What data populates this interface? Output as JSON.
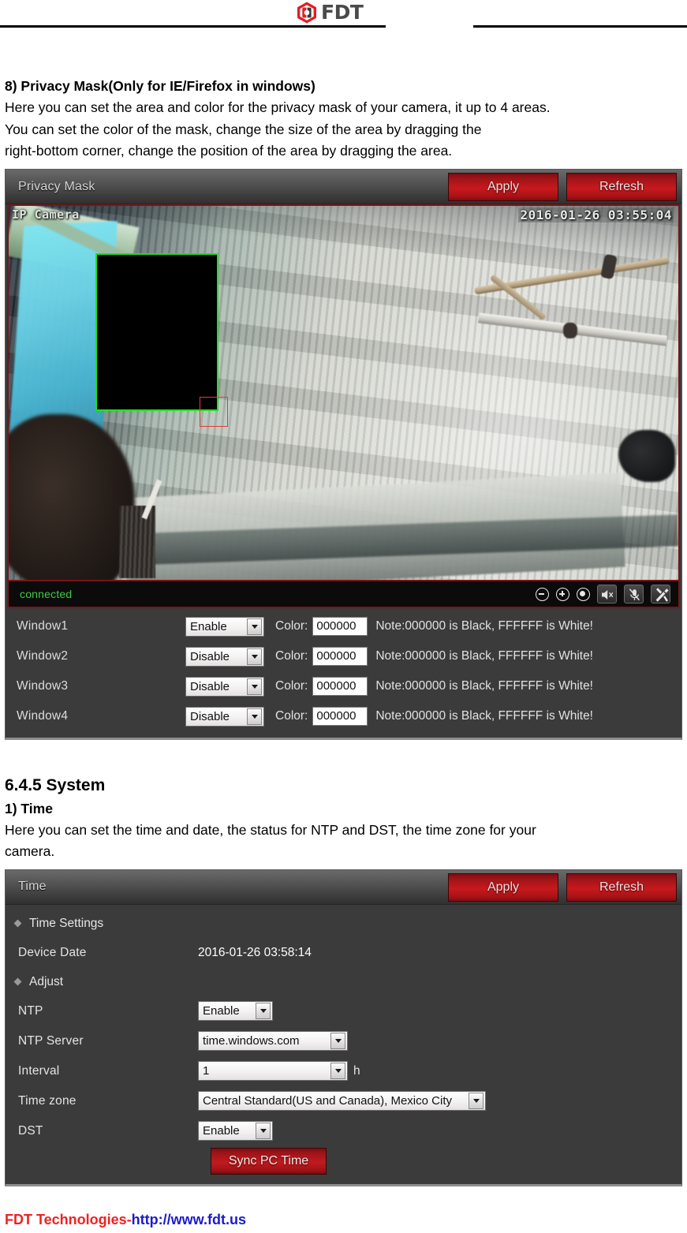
{
  "header": {
    "logo_text": "FDT",
    "logo_icon": "fdt-hexagon-logo"
  },
  "doc": {
    "section8_heading": "8) Privacy Mask(Only for IE/Firefox in windows)",
    "section8_para_line1": "Here you can set the area and color for the privacy mask of your camera, it up to 4 areas.",
    "section8_para_line2": "You can set the color of the mask, change the size of the area by dragging the",
    "section8_para_line3": "right-bottom corner, change the position of the area by dragging the area.",
    "section645_heading": "6.4.5 System",
    "subsection1_heading": "1) Time",
    "subsection1_para_line1": "Here you can set the time and date, the status for NTP and DST, the time zone for your",
    "subsection1_para_line2": "camera."
  },
  "privacy_panel": {
    "title": "Privacy Mask",
    "apply_label": "Apply",
    "refresh_label": "Refresh",
    "video": {
      "overlay_label": "IP Camera",
      "overlay_timestamp": "2016-01-26  03:55:04",
      "status_text": "connected",
      "icons": [
        "zoom-out-icon",
        "zoom-in-icon",
        "record-dot-icon",
        "speaker-mute-icon",
        "mic-mute-icon",
        "tools-icon"
      ]
    },
    "color_label": "Color:",
    "note_text": "Note:000000 is Black, FFFFFF is White!",
    "rows": [
      {
        "label": "Window1",
        "state": "Enable",
        "color": "000000"
      },
      {
        "label": "Window2",
        "state": "Disable",
        "color": "000000"
      },
      {
        "label": "Window3",
        "state": "Disable",
        "color": "000000"
      },
      {
        "label": "Window4",
        "state": "Disable",
        "color": "000000"
      }
    ],
    "state_options": [
      "Enable",
      "Disable"
    ]
  },
  "time_panel": {
    "title": "Time",
    "apply_label": "Apply",
    "refresh_label": "Refresh",
    "group_time_settings": "Time Settings",
    "group_adjust": "Adjust",
    "device_date_label": "Device Date",
    "device_date_value": "2016-01-26 03:58:14",
    "ntp_label": "NTP",
    "ntp_value": "Enable",
    "ntp_options": [
      "Enable",
      "Disable"
    ],
    "ntp_server_label": "NTP Server",
    "ntp_server_value": "time.windows.com",
    "interval_label": "Interval",
    "interval_value": "1",
    "interval_unit": "h",
    "timezone_label": "Time zone",
    "timezone_value": "Central Standard(US and Canada), Mexico City",
    "dst_label": "DST",
    "dst_value": "Enable",
    "dst_options": [
      "Enable",
      "Disable"
    ],
    "sync_button_label": "Sync PC Time"
  },
  "footer": {
    "company": "FDT Technologies-",
    "url": "http://www.fdt.us"
  },
  "colors": {
    "brand_red": "#c8191d",
    "panel_bg": "#3b3b3b",
    "mask_outline_green": "#22e022",
    "handle_red": "#e23b3b",
    "connected_green": "#3fcc3f",
    "footer_red": "#ef2222",
    "footer_blue": "#1a1ad0"
  }
}
